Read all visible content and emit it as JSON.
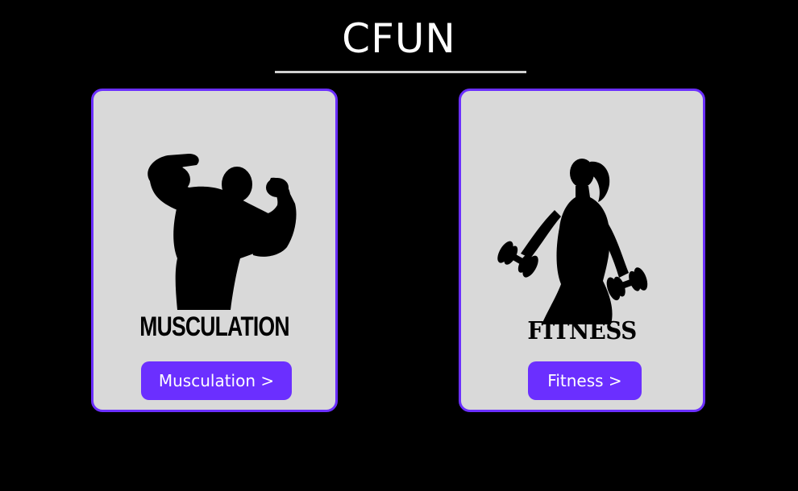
{
  "header": {
    "title": "CFUN"
  },
  "cards": [
    {
      "label": "MUSCULATION",
      "button_label": "Musculation >",
      "icon": "bodybuilder-silhouette-icon"
    },
    {
      "label": "FITNESS",
      "button_label": "Fitness >",
      "icon": "fitness-woman-dumbbells-icon"
    }
  ],
  "colors": {
    "background": "#000000",
    "card_background": "#d9d9d9",
    "accent": "#6b2fff",
    "text_light": "#ffffff",
    "underline": "#d0d0d0"
  }
}
